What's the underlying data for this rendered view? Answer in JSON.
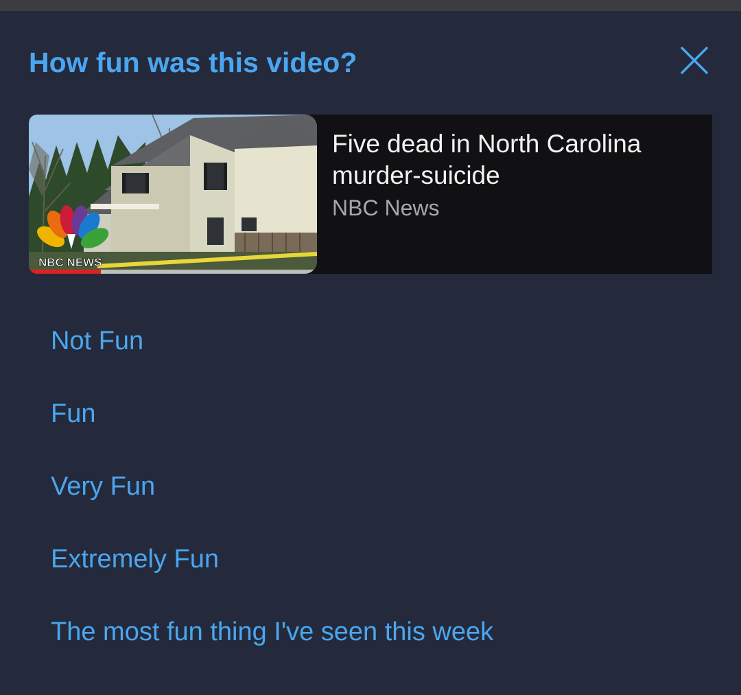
{
  "dialog": {
    "title": "How fun was this video?",
    "close_icon": "close-icon",
    "accent_color": "#4aa6f0",
    "background_color": "#242a3b"
  },
  "video": {
    "title": "Five dead in North Carolina murder-suicide",
    "channel": "NBC News",
    "thumbnail_logo_text": "NBC NEWS",
    "thumbnail_icon": "nbc-peacock-logo"
  },
  "options": [
    {
      "label": "Not Fun"
    },
    {
      "label": "Fun"
    },
    {
      "label": "Very Fun"
    },
    {
      "label": "Extremely Fun"
    },
    {
      "label": "The most fun thing I've seen this week"
    }
  ]
}
